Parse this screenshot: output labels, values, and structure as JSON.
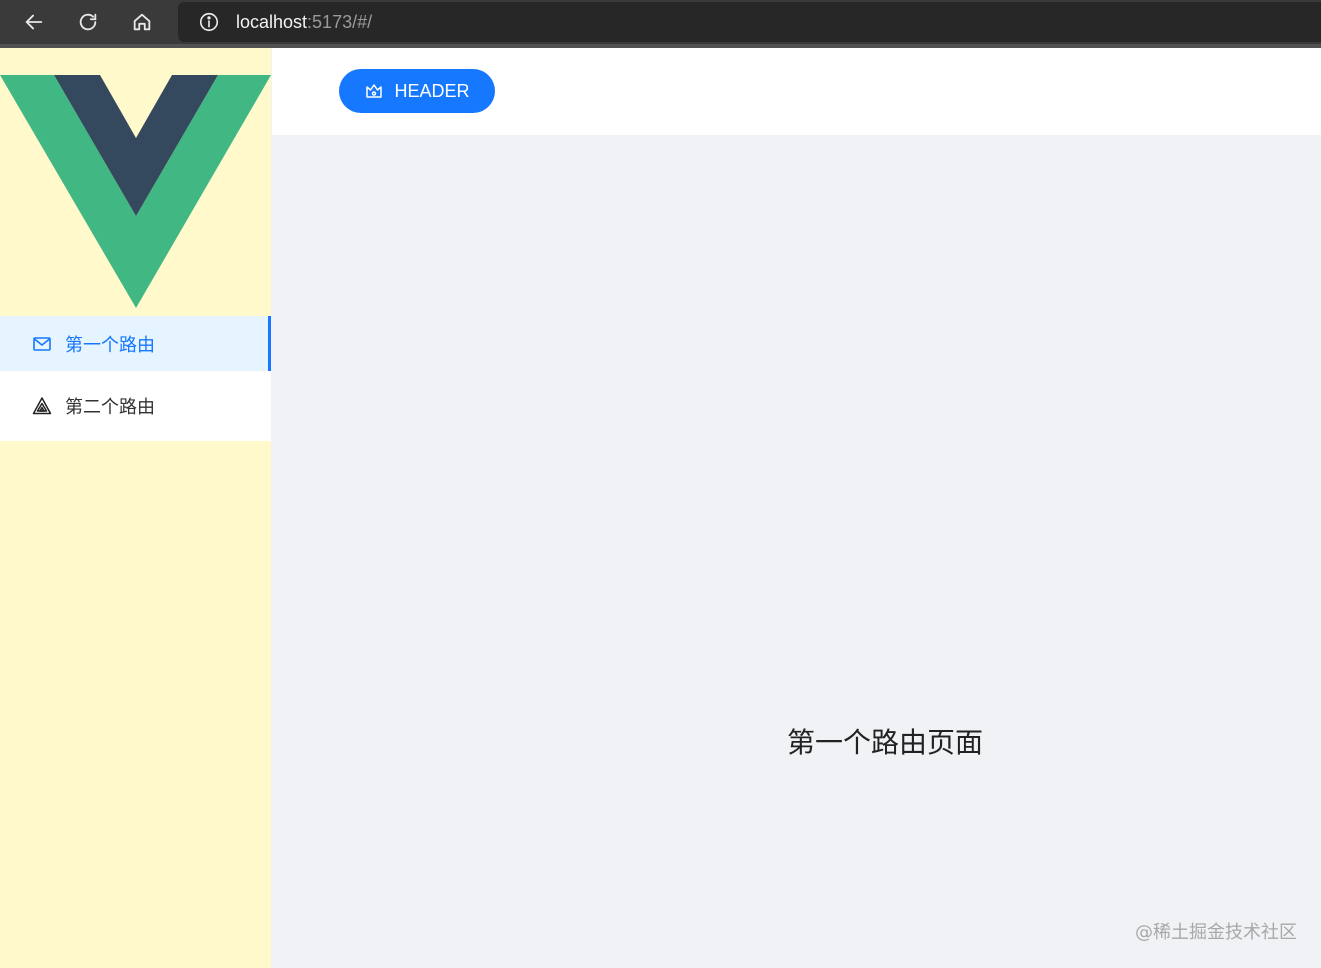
{
  "browser": {
    "url_host": "localhost",
    "url_rest": ":5173/#/"
  },
  "sidebar": {
    "items": [
      {
        "label": "第一个路由",
        "icon": "mail-icon",
        "active": true
      },
      {
        "label": "第二个路由",
        "icon": "triangle-icon",
        "active": false
      }
    ]
  },
  "header": {
    "button_label": "HEADER",
    "button_icon": "crown-icon"
  },
  "content": {
    "page_text": "第一个路由页面"
  },
  "watermark": "@稀土掘金技术社区",
  "colors": {
    "accent": "#1677ff",
    "sidebar_bg": "#fff9cc",
    "vue_green": "#41b883",
    "vue_dark": "#34495e"
  }
}
